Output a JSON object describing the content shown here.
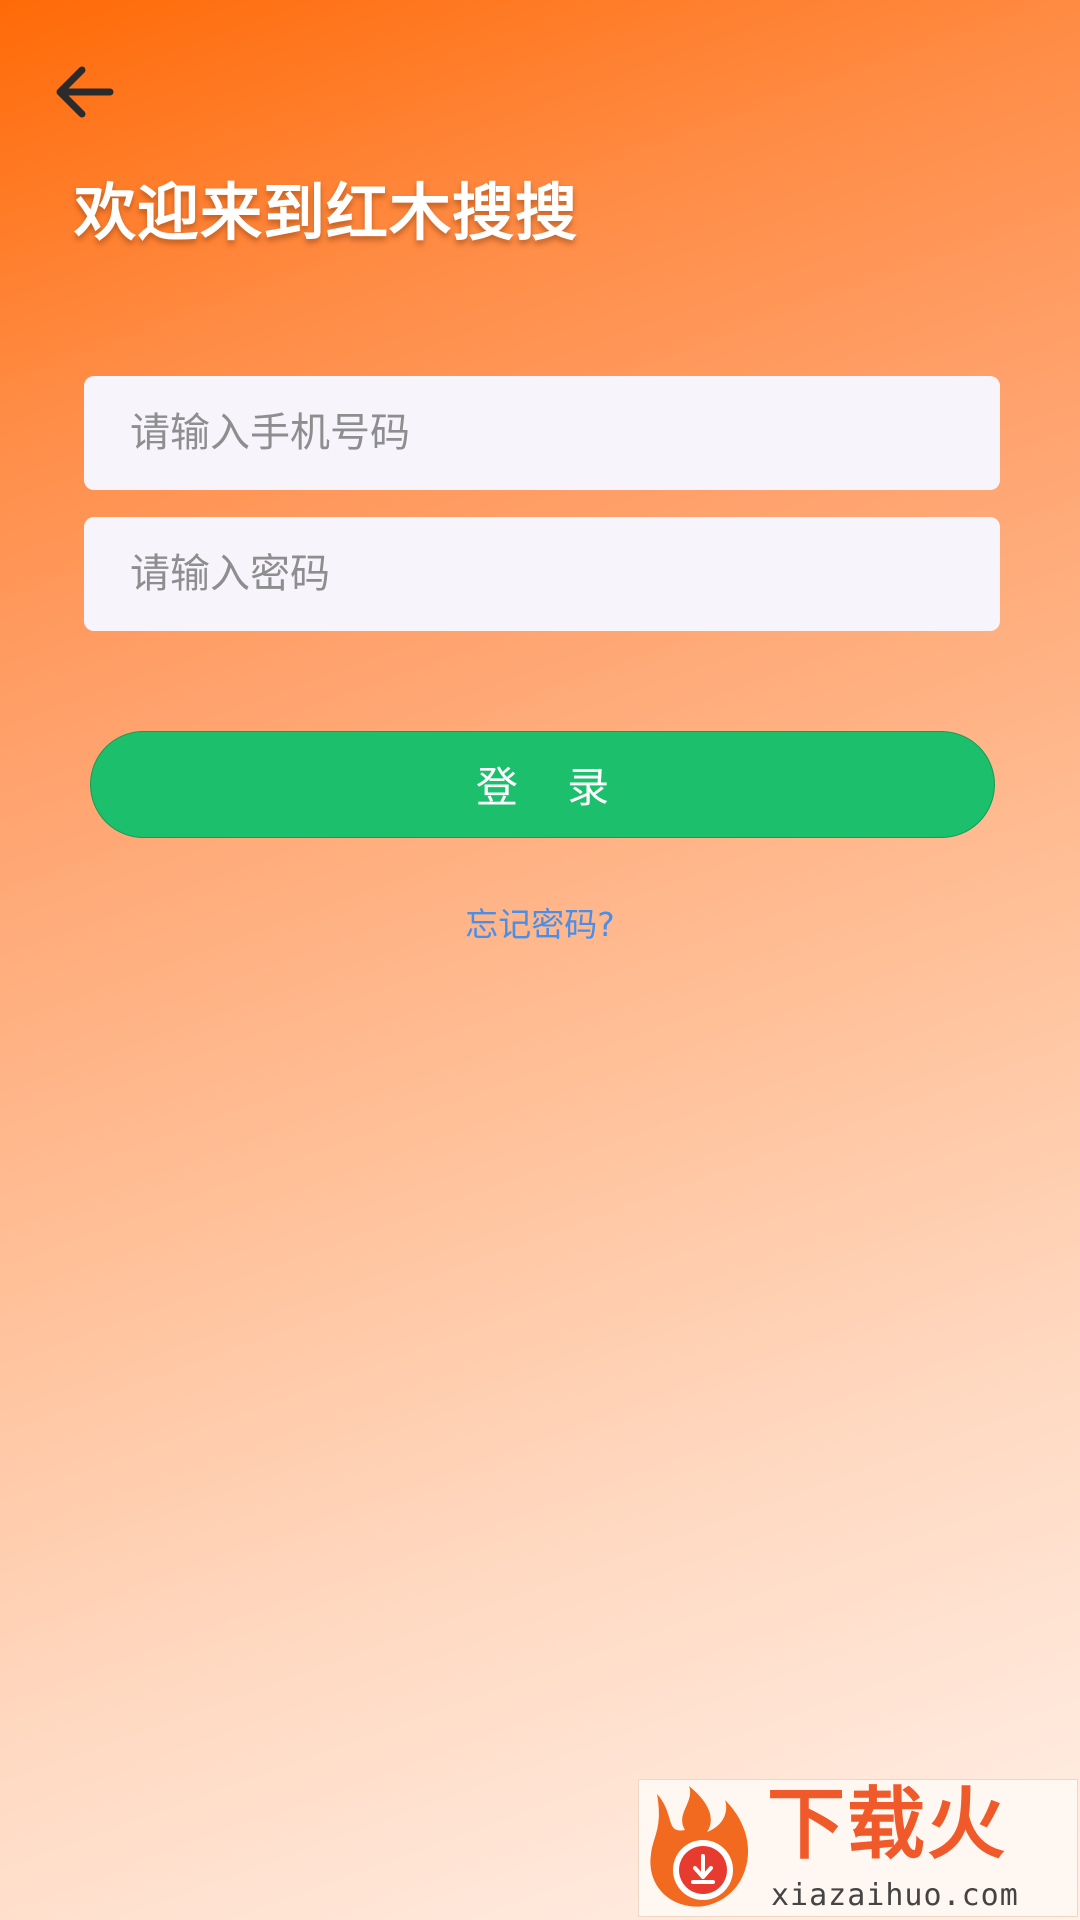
{
  "header": {
    "back_icon": "arrow-left-icon",
    "title": "欢迎来到红木搜搜"
  },
  "form": {
    "phone_placeholder": "请输入手机号码",
    "phone_value": "",
    "password_placeholder": "请输入密码",
    "password_value": "",
    "login_label": "登 录",
    "forgot_label": "忘记密码?"
  },
  "watermark": {
    "brand": "下载火",
    "url": "xiazaihuo.com",
    "logo_icon": "flame-download-icon"
  },
  "colors": {
    "gradient_start": "#ff6a07",
    "gradient_end": "#fff0e8",
    "login_button": "#1bbf6c",
    "link": "#4a8ee8",
    "input_bg": "#f7f4fc"
  }
}
